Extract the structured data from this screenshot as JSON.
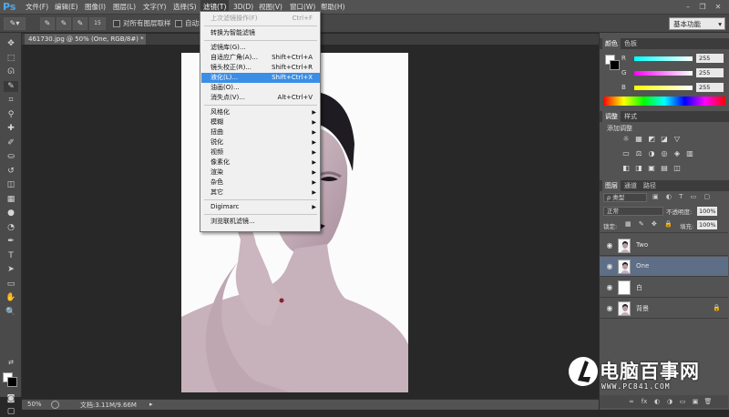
{
  "app": {
    "logo": "Ps"
  },
  "menubar": {
    "items": [
      "文件(F)",
      "编辑(E)",
      "图像(I)",
      "图层(L)",
      "文字(Y)",
      "选择(S)",
      "滤镜(T)",
      "3D(D)",
      "视图(V)",
      "窗口(W)",
      "帮助(H)"
    ],
    "active": "滤镜(T)"
  },
  "window_controls": {
    "minimize": "–",
    "restore": "❐",
    "close": "✕"
  },
  "options_bar": {
    "brush_size": "15",
    "sample_all_label": "对所有图层取样",
    "auto_enhance_label": "自动增",
    "workspace": "基本功能"
  },
  "document_tab": {
    "label": "461730.jpg @ 50% (One, RGB/8#) *",
    "close": "×"
  },
  "status_bar": {
    "zoom": "50%",
    "doc_info": "文档:3.11M/9.66M",
    "arrow": "▸"
  },
  "filter_menu": {
    "items": [
      {
        "label": "上次滤镜操作(F)",
        "shortcut": "Ctrl+F",
        "disabled": true
      },
      {
        "sep": true
      },
      {
        "label": "转换为智能滤镜",
        "shortcut": ""
      },
      {
        "sep": true
      },
      {
        "label": "滤镜库(G)...",
        "shortcut": ""
      },
      {
        "label": "自适应广角(A)...",
        "shortcut": "Shift+Ctrl+A"
      },
      {
        "label": "镜头校正(R)...",
        "shortcut": "Shift+Ctrl+R"
      },
      {
        "label": "液化(L)...",
        "shortcut": "Shift+Ctrl+X",
        "highlighted": true
      },
      {
        "label": "油画(O)...",
        "shortcut": ""
      },
      {
        "label": "消失点(V)...",
        "shortcut": "Alt+Ctrl+V"
      },
      {
        "sep": true
      },
      {
        "label": "风格化",
        "submenu": true
      },
      {
        "label": "模糊",
        "submenu": true
      },
      {
        "label": "扭曲",
        "submenu": true
      },
      {
        "label": "锐化",
        "submenu": true
      },
      {
        "label": "视频",
        "submenu": true
      },
      {
        "label": "像素化",
        "submenu": true
      },
      {
        "label": "渲染",
        "submenu": true
      },
      {
        "label": "杂色",
        "submenu": true
      },
      {
        "label": "其它",
        "submenu": true
      },
      {
        "sep": true
      },
      {
        "label": "Digimarc",
        "submenu": true
      },
      {
        "sep": true
      },
      {
        "label": "浏览联机滤镜...",
        "shortcut": ""
      }
    ],
    "submenu_arrow": "▶"
  },
  "color_panel": {
    "tabs": [
      "颜色",
      "色板"
    ],
    "channels": [
      {
        "label": "R",
        "value": "255"
      },
      {
        "label": "G",
        "value": "255"
      },
      {
        "label": "B",
        "value": "255"
      }
    ]
  },
  "adjustments_panel": {
    "tabs": [
      "调整",
      "样式"
    ],
    "title": "添加调整"
  },
  "layers_panel": {
    "tabs": [
      "图层",
      "通道",
      "路径"
    ],
    "filter_kind": "ρ 类型",
    "blend_mode": "正常",
    "opacity_label": "不透明度:",
    "opacity_value": "100%",
    "lock_label": "锁定:",
    "fill_label": "填充:",
    "fill_value": "100%",
    "layers": [
      {
        "name": "Two",
        "selected": false,
        "thumb": "portrait"
      },
      {
        "name": "One",
        "selected": true,
        "thumb": "portrait"
      },
      {
        "name": "白",
        "selected": false,
        "thumb": "white"
      },
      {
        "name": "背景",
        "selected": false,
        "thumb": "portrait",
        "locked": true
      }
    ],
    "footer_icons": [
      "∞",
      "fx",
      "◐",
      "◑",
      "▭",
      "▣",
      "🗑"
    ]
  },
  "watermark": {
    "title": "电脑百事网",
    "url": "WWW.PC841.COM"
  },
  "icons": {
    "tools": [
      "move-icon",
      "marquee-icon",
      "lasso-icon",
      "quick-select-icon",
      "crop-icon",
      "eyedropper-icon",
      "healing-brush-icon",
      "brush-icon",
      "clone-stamp-icon",
      "history-brush-icon",
      "eraser-icon",
      "gradient-icon",
      "blur-icon",
      "dodge-icon",
      "pen-icon",
      "type-icon",
      "path-select-icon",
      "rectangle-icon",
      "hand-icon",
      "zoom-icon"
    ],
    "tool_glyphs": [
      "✥",
      "⬚",
      "ᘏ",
      "✎",
      "⌗",
      "⚲",
      "✚",
      "✐",
      "⛀",
      "↺",
      "◫",
      "▦",
      "●",
      "◔",
      "✒",
      "T",
      "➤",
      "▭",
      "✋",
      "🔍"
    ]
  },
  "colors": {
    "accent": "#3a8ee6",
    "selected_layer": "#5d6e86",
    "logo": "#4fa9e8"
  }
}
